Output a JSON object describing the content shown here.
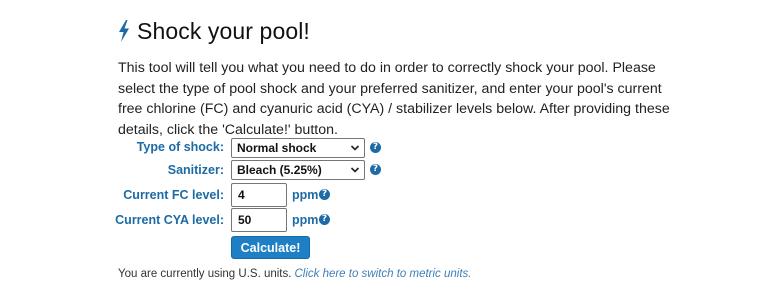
{
  "header": {
    "title": "Shock your pool!",
    "icon": "lightning-bolt-icon",
    "icon_color": "#1d6aa5"
  },
  "intro": "This tool will tell you what you need to do in order to correctly shock your pool. Please select the type of pool shock and your preferred sanitizer, and enter your pool's current free chlorine (FC) and cyanuric acid (CYA) / stabilizer levels below. After providing these details, click the 'Calculate!' button.",
  "form": {
    "shock_type": {
      "label": "Type of shock:",
      "value": "Normal shock"
    },
    "sanitizer": {
      "label": "Sanitizer:",
      "value": "Bleach (5.25%)"
    },
    "fc_level": {
      "label": "Current FC level:",
      "value": "4",
      "unit": "ppm"
    },
    "cya_level": {
      "label": "Current CYA level:",
      "value": "50",
      "unit": "ppm"
    },
    "help_glyph": "?",
    "calculate_label": "Calculate!"
  },
  "units": {
    "note": "You are currently using U.S. units.",
    "switch_link": "Click here to switch to metric units."
  },
  "colors": {
    "accent": "#1d6aa5",
    "button": "#1e7fc4",
    "link": "#3f7fb6"
  }
}
